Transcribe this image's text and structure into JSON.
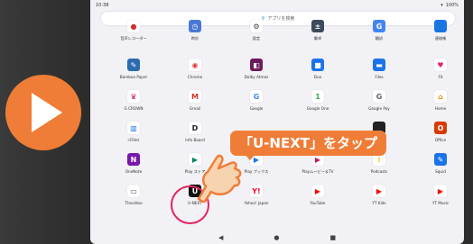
{
  "statusbar": {
    "time": "10:38",
    "battery": "100%"
  },
  "search": {
    "placeholder": "アプリを検索"
  },
  "apps": [
    {
      "label": "音声レコーダー",
      "color": "#ffffff",
      "glyph": "●",
      "fg": "#d32f2f",
      "icon": "recorder-icon"
    },
    {
      "label": "時計",
      "color": "#4a78d6",
      "glyph": "◷",
      "fg": "#ffffff",
      "icon": "clock-icon"
    },
    {
      "label": "設定",
      "color": "#ffffff",
      "glyph": "⚙",
      "fg": "#444444",
      "icon": "settings-icon"
    },
    {
      "label": "電卓",
      "color": "#3c4a5a",
      "glyph": "±",
      "fg": "#ffffff",
      "icon": "calculator-icon"
    },
    {
      "label": "翻訳",
      "color": "#4285f4",
      "glyph": "G",
      "fg": "#ffffff",
      "icon": "translate-icon"
    },
    {
      "label": "連絡帳",
      "color": "#1a73e8",
      "glyph": "👤",
      "fg": "#ffffff",
      "icon": "contacts-icon"
    },
    {
      "label": "Bamboo Paper",
      "color": "#2b6cb0",
      "glyph": "✎",
      "fg": "#ffffff",
      "icon": "bamboo-paper-icon"
    },
    {
      "label": "Chrome",
      "color": "#ffffff",
      "glyph": "◉",
      "fg": "#db4437",
      "icon": "chrome-icon"
    },
    {
      "label": "Dolby Atmos",
      "color": "#6b1b5c",
      "glyph": "◧",
      "fg": "#ffffff",
      "icon": "dolby-icon"
    },
    {
      "label": "Duo",
      "color": "#1a73e8",
      "glyph": "■",
      "fg": "#ffffff",
      "icon": "duo-icon"
    },
    {
      "label": "Files",
      "color": "#1a73e8",
      "glyph": "▬",
      "fg": "#ffffff",
      "icon": "files-icon"
    },
    {
      "label": "Fit",
      "color": "#ffffff",
      "glyph": "♥",
      "fg": "#e91e63",
      "icon": "fit-icon"
    },
    {
      "label": "G CROWN",
      "color": "#ffffff",
      "glyph": "♛",
      "fg": "#c2185b",
      "icon": "gcrown-icon"
    },
    {
      "label": "Gmail",
      "color": "#ffffff",
      "glyph": "M",
      "fg": "#d93025",
      "icon": "gmail-icon"
    },
    {
      "label": "Google",
      "color": "#ffffff",
      "glyph": "G",
      "fg": "#4285f4",
      "icon": "google-icon"
    },
    {
      "label": "Google One",
      "color": "#ffffff",
      "glyph": "1",
      "fg": "#34a853",
      "icon": "google-one-icon"
    },
    {
      "label": "Google Pay",
      "color": "#ffffff",
      "glyph": "G",
      "fg": "#5f6368",
      "icon": "google-pay-icon"
    },
    {
      "label": "Home",
      "color": "#ffffff",
      "glyph": "⌂",
      "fg": "#ea8600",
      "icon": "home-icon"
    },
    {
      "label": "i-Filter",
      "color": "#ffffff",
      "glyph": "▥",
      "fg": "#1a73e8",
      "icon": "ifilter-icon"
    },
    {
      "label": "Info Board",
      "color": "#ffffff",
      "glyph": "D",
      "fg": "#222222",
      "icon": "info-board-icon"
    },
    {
      "label": "",
      "color": "#f1f1f6",
      "glyph": "",
      "fg": "#f1f1f6",
      "icon": "hidden-app-icon"
    },
    {
      "label": "",
      "color": "#f1f1f6",
      "glyph": "",
      "fg": "#f1f1f6",
      "icon": "hidden-app-icon"
    },
    {
      "label": "",
      "color": "#222222",
      "glyph": "",
      "fg": "#ffffff",
      "icon": "hidden-app-icon"
    },
    {
      "label": "Office",
      "color": "#d83b01",
      "glyph": "O",
      "fg": "#ffffff",
      "icon": "office-icon"
    },
    {
      "label": "OneNote",
      "color": "#7719aa",
      "glyph": "N",
      "fg": "#ffffff",
      "icon": "onenote-icon"
    },
    {
      "label": "Play ストア",
      "color": "#ffffff",
      "glyph": "▶",
      "fg": "#01875f",
      "icon": "play-store-icon"
    },
    {
      "label": "Play ブックス",
      "color": "#ffffff",
      "glyph": "▶",
      "fg": "#1a73e8",
      "icon": "play-books-icon"
    },
    {
      "label": "Playムービー＆TV",
      "color": "#ffffff",
      "glyph": "▶",
      "fg": "#c2185b",
      "icon": "play-movies-icon"
    },
    {
      "label": "Podcasts",
      "color": "#ffffff",
      "glyph": "⁞",
      "fg": "#fbbc04",
      "icon": "podcasts-icon"
    },
    {
      "label": "Squid",
      "color": "#1a73e8",
      "glyph": "✎",
      "fg": "#ffffff",
      "icon": "squid-icon"
    },
    {
      "label": "Theoldoo",
      "color": "#ffffff",
      "glyph": "▭",
      "fg": "#555555",
      "icon": "theoldoo-icon"
    },
    {
      "label": "U-NEXT",
      "color": "#111111",
      "glyph": "U",
      "fg": "#ffffff",
      "icon": "unext-icon"
    },
    {
      "label": "Yahoo! Japan",
      "color": "#ffffff",
      "glyph": "Y!",
      "fg": "#ff0033",
      "icon": "yahoo-icon"
    },
    {
      "label": "YouTube",
      "color": "#ffffff",
      "glyph": "▶",
      "fg": "#ff0000",
      "icon": "youtube-icon"
    },
    {
      "label": "YT Kids",
      "color": "#ffffff",
      "glyph": "▶",
      "fg": "#ff0000",
      "icon": "yt-kids-icon"
    },
    {
      "label": "YT Music",
      "color": "#ffffff",
      "glyph": "▶",
      "fg": "#ff0000",
      "icon": "yt-music-icon"
    }
  ],
  "callout": {
    "text": "「U-NEXT」をタップ"
  },
  "navbar": {
    "back": "◀",
    "home": "●",
    "recents": "■"
  },
  "colors": {
    "accent": "#ef7d37",
    "ring": "#e5245e"
  }
}
